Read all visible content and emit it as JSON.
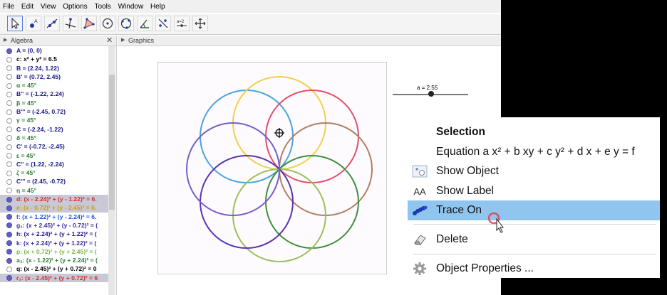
{
  "menubar": {
    "items": [
      "File",
      "Edit",
      "View",
      "Options",
      "Tools",
      "Window",
      "Help"
    ]
  },
  "toolbar": {
    "tools": [
      "move-tool",
      "point-tool",
      "line-tool",
      "perpendicular-line-tool",
      "polygon-tool",
      "circle-tool",
      "circle-three-points-tool",
      "angle-tool",
      "reflect-tool",
      "slider-tool",
      "move-graphics-view-tool"
    ],
    "slider_tool_text": "a=2"
  },
  "algebra": {
    "title": "Algebra",
    "close_label": "✕",
    "rows": [
      {
        "text": "A = (0, 0)",
        "color": "#1a1a8c",
        "visible": true,
        "highlight": false
      },
      {
        "text": "c: x² + y² = 6.5",
        "color": "#000000",
        "visible": false,
        "highlight": false
      },
      {
        "text": "B = (2.24, 1.22)",
        "color": "#1a1a8c",
        "visible": false,
        "highlight": false
      },
      {
        "text": "B' = (0.72, 2.45)",
        "color": "#1a1a8c",
        "visible": false,
        "highlight": false
      },
      {
        "text": "α = 45°",
        "color": "#2e7d32",
        "visible": false,
        "highlight": false
      },
      {
        "text": "B'' = (-1.22, 2.24)",
        "color": "#1a1a8c",
        "visible": false,
        "highlight": false
      },
      {
        "text": "β = 45°",
        "color": "#2e7d32",
        "visible": false,
        "highlight": false
      },
      {
        "text": "B''' = (-2.45, 0.72)",
        "color": "#1a1a8c",
        "visible": false,
        "highlight": false
      },
      {
        "text": "γ = 45°",
        "color": "#2e7d32",
        "visible": false,
        "highlight": false
      },
      {
        "text": "C = (-2.24, -1.22)",
        "color": "#1a1a8c",
        "visible": false,
        "highlight": false
      },
      {
        "text": "δ = 45°",
        "color": "#2e7d32",
        "visible": false,
        "highlight": false
      },
      {
        "text": "C' = (-0.72, -2.45)",
        "color": "#1a1a8c",
        "visible": false,
        "highlight": false
      },
      {
        "text": "ε = 45°",
        "color": "#2e7d32",
        "visible": false,
        "highlight": false
      },
      {
        "text": "C'' = (1.22, -2.24)",
        "color": "#1a1a8c",
        "visible": false,
        "highlight": false
      },
      {
        "text": "ζ = 45°",
        "color": "#2e7d32",
        "visible": false,
        "highlight": false
      },
      {
        "text": "C''' = (2.45, -0.72)",
        "color": "#1a1a8c",
        "visible": false,
        "highlight": false
      },
      {
        "text": "η = 45°",
        "color": "#2e7d32",
        "visible": false,
        "highlight": false
      },
      {
        "text": "d: (x - 2.24)² + (y - 1.22)² = 6.",
        "color": "#d32f2f",
        "visible": true,
        "highlight": true
      },
      {
        "text": "e: (x - 0.72)² + (y - 2.45)² = 6.",
        "color": "#c9a000",
        "visible": true,
        "highlight": true
      },
      {
        "text": "f: (x + 1.22)² + (y - 2.24)² = 6.",
        "color": "#1e5bd8",
        "visible": true,
        "highlight": false
      },
      {
        "text": "g₁: (x + 2.45)² + (y - 0.72)² = (",
        "color": "#3a2ea0",
        "visible": true,
        "highlight": false
      },
      {
        "text": "h: (x + 2.24)² + (y + 1.22)² = (",
        "color": "#1a1a8c",
        "visible": true,
        "highlight": false
      },
      {
        "text": "k: (x + 2.24)² + (y + 1.22)² = (",
        "color": "#3a2ea0",
        "visible": true,
        "highlight": false
      },
      {
        "text": "p: (x + 0.72)² + (y + 2.45)² = (",
        "color": "#7cb342",
        "visible": true,
        "highlight": false
      },
      {
        "text": "a₂: (x - 1.22)² + (y + 2.24)² = (",
        "color": "#2e7d32",
        "visible": true,
        "highlight": false
      },
      {
        "text": "q: (x - 2.45)² + (y + 0.72)² = 0",
        "color": "#000000",
        "visible": false,
        "highlight": false
      },
      {
        "text": "r₁: (x - 2.45)² + (y + 0.72)² = 6",
        "color": "#d32f2f",
        "visible": true,
        "highlight": true
      }
    ]
  },
  "graphics": {
    "title": "Graphics",
    "slider": {
      "label": "a = 2.55",
      "value": 2.55,
      "min": 0,
      "max": 5
    },
    "circles": [
      {
        "name": "blue",
        "color": "#4aa3dd"
      },
      {
        "name": "gold",
        "color": "#f2cf4a"
      },
      {
        "name": "red",
        "color": "#e0506a"
      },
      {
        "name": "brown",
        "color": "#b08060"
      },
      {
        "name": "green",
        "color": "#3f8f3f"
      },
      {
        "name": "lightgreen",
        "color": "#9bbf5a"
      },
      {
        "name": "purple",
        "color": "#5a34b0"
      },
      {
        "name": "violet",
        "color": "#7a5cc8"
      }
    ]
  },
  "context_menu": {
    "items": [
      {
        "label": "Selection",
        "icon": "",
        "type": "header"
      },
      {
        "label": "Equation a x² + b xy + c y² + d x + e y = f",
        "icon": "",
        "type": "item"
      },
      {
        "label": "Show Object",
        "icon": "show-object-icon",
        "type": "item"
      },
      {
        "label": "Show Label",
        "icon": "show-label-icon",
        "type": "item"
      },
      {
        "label": "Trace On",
        "icon": "trace-icon",
        "type": "active"
      },
      {
        "label": "Delete",
        "icon": "eraser-icon",
        "type": "item"
      },
      {
        "label": "Object Properties ...",
        "icon": "gear-icon",
        "type": "item"
      }
    ],
    "show_label_icon_text": "AA"
  }
}
